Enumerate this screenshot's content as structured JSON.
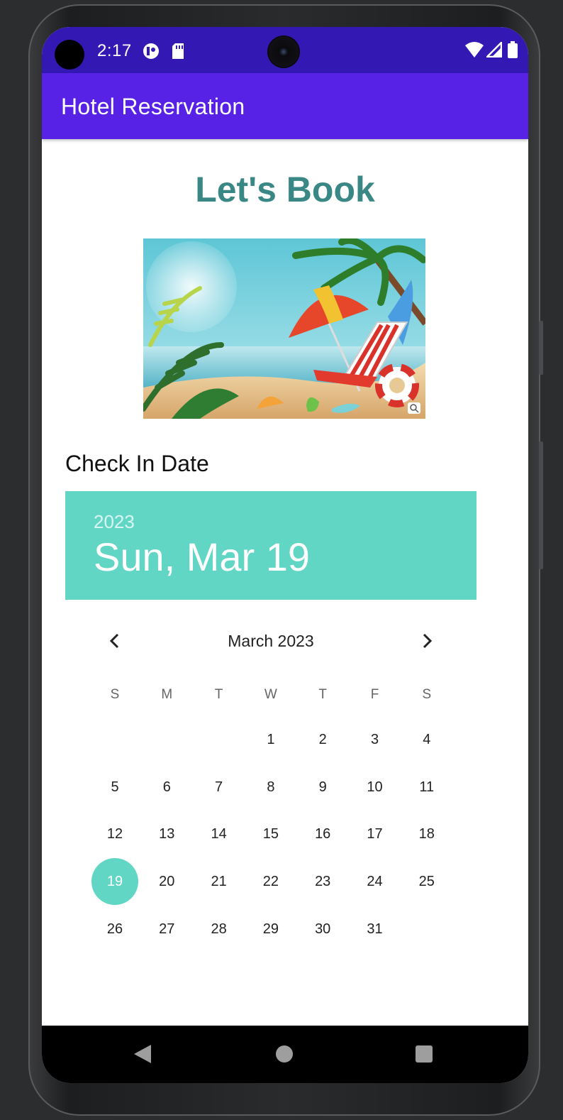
{
  "status_bar": {
    "time": "2:17"
  },
  "app_bar": {
    "title": "Hotel Reservation"
  },
  "main": {
    "heading": "Let's Book",
    "check_in_label": "Check In Date"
  },
  "date_picker": {
    "header_year": "2023",
    "header_date": "Sun, Mar 19",
    "month_label": "March 2023",
    "weekdays": [
      "S",
      "M",
      "T",
      "W",
      "T",
      "F",
      "S"
    ],
    "first_weekday_index": 3,
    "days": [
      "1",
      "2",
      "3",
      "4",
      "5",
      "6",
      "7",
      "8",
      "9",
      "10",
      "11",
      "12",
      "13",
      "14",
      "15",
      "16",
      "17",
      "18",
      "19",
      "20",
      "21",
      "22",
      "23",
      "24",
      "25",
      "26",
      "27",
      "28",
      "29",
      "30",
      "31"
    ],
    "selected_day": "19",
    "accent_color": "#62d6c5"
  },
  "colors": {
    "status_bar": "#3318b4",
    "app_bar": "#5822e6",
    "heading": "#3a8885"
  },
  "icons": {
    "status": [
      "media-icon",
      "sd-card-icon",
      "wifi-icon",
      "signal-icon",
      "battery-icon"
    ],
    "calendar_nav": [
      "chevron-left-icon",
      "chevron-right-icon"
    ],
    "system_nav": [
      "back-icon",
      "home-icon",
      "recents-icon"
    ]
  }
}
